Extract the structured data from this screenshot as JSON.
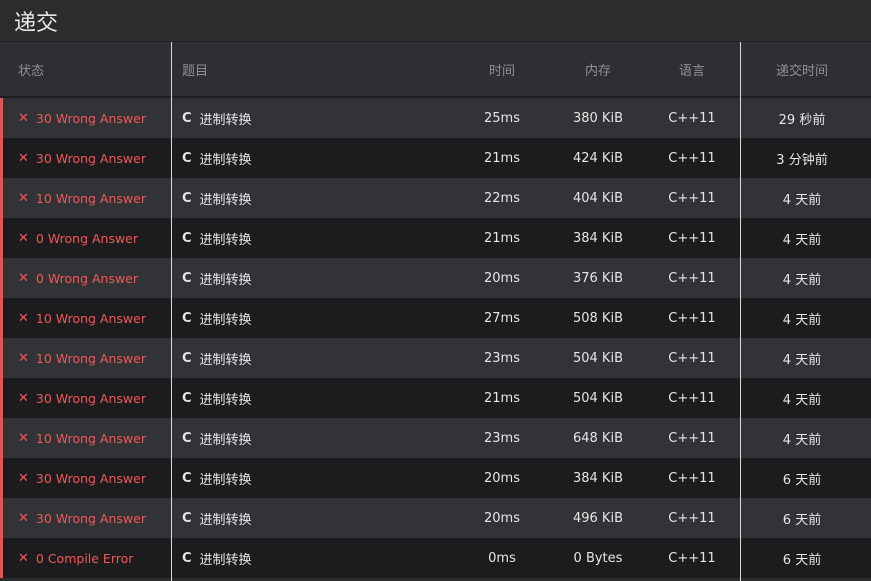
{
  "page": {
    "title": "递交"
  },
  "columns": {
    "status": "状态",
    "problem": "题目",
    "time": "时间",
    "memory": "内存",
    "language": "语言",
    "submitted": "递交时间"
  },
  "colors": {
    "fail": "#f25757",
    "row_light": "#323336",
    "row_dark": "#1c1c1e"
  },
  "rows": [
    {
      "status_icon": "close-icon",
      "status": "30 Wrong Answer",
      "lang_badge": "C",
      "problem": "进制转换",
      "time": "25ms",
      "memory": "380 KiB",
      "language": "C++11",
      "submitted": "29 秒前"
    },
    {
      "status_icon": "close-icon",
      "status": "30 Wrong Answer",
      "lang_badge": "C",
      "problem": "进制转换",
      "time": "21ms",
      "memory": "424 KiB",
      "language": "C++11",
      "submitted": "3 分钟前"
    },
    {
      "status_icon": "close-icon",
      "status": "10 Wrong Answer",
      "lang_badge": "C",
      "problem": "进制转换",
      "time": "22ms",
      "memory": "404 KiB",
      "language": "C++11",
      "submitted": "4 天前"
    },
    {
      "status_icon": "close-icon",
      "status": "0 Wrong Answer",
      "lang_badge": "C",
      "problem": "进制转换",
      "time": "21ms",
      "memory": "384 KiB",
      "language": "C++11",
      "submitted": "4 天前"
    },
    {
      "status_icon": "close-icon",
      "status": "0 Wrong Answer",
      "lang_badge": "C",
      "problem": "进制转换",
      "time": "20ms",
      "memory": "376 KiB",
      "language": "C++11",
      "submitted": "4 天前"
    },
    {
      "status_icon": "close-icon",
      "status": "10 Wrong Answer",
      "lang_badge": "C",
      "problem": "进制转换",
      "time": "27ms",
      "memory": "508 KiB",
      "language": "C++11",
      "submitted": "4 天前"
    },
    {
      "status_icon": "close-icon",
      "status": "10 Wrong Answer",
      "lang_badge": "C",
      "problem": "进制转换",
      "time": "23ms",
      "memory": "504 KiB",
      "language": "C++11",
      "submitted": "4 天前"
    },
    {
      "status_icon": "close-icon",
      "status": "30 Wrong Answer",
      "lang_badge": "C",
      "problem": "进制转换",
      "time": "21ms",
      "memory": "504 KiB",
      "language": "C++11",
      "submitted": "4 天前"
    },
    {
      "status_icon": "close-icon",
      "status": "10 Wrong Answer",
      "lang_badge": "C",
      "problem": "进制转换",
      "time": "23ms",
      "memory": "648 KiB",
      "language": "C++11",
      "submitted": "4 天前"
    },
    {
      "status_icon": "close-icon",
      "status": "30 Wrong Answer",
      "lang_badge": "C",
      "problem": "进制转换",
      "time": "20ms",
      "memory": "384 KiB",
      "language": "C++11",
      "submitted": "6 天前"
    },
    {
      "status_icon": "close-icon",
      "status": "30 Wrong Answer",
      "lang_badge": "C",
      "problem": "进制转换",
      "time": "20ms",
      "memory": "496 KiB",
      "language": "C++11",
      "submitted": "6 天前"
    },
    {
      "status_icon": "close-icon",
      "status": "0 Compile Error",
      "lang_badge": "C",
      "problem": "进制转换",
      "time": "0ms",
      "memory": "0 Bytes",
      "language": "C++11",
      "submitted": "6 天前"
    }
  ]
}
